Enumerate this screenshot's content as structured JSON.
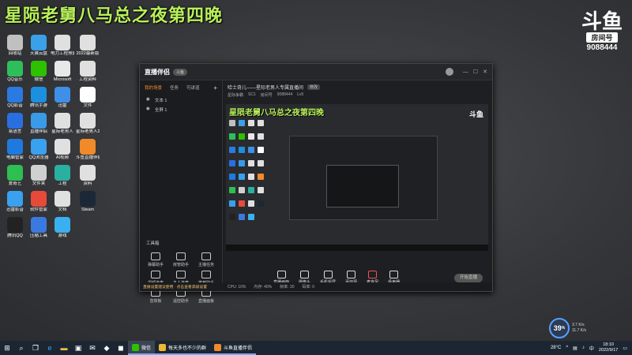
{
  "stream_overlay": {
    "title": "星陨老舅八马总之夜第四晚",
    "platform_mark": "斗鱼",
    "room_label": "房间号",
    "room_number": "9088444"
  },
  "desktop_icons": [
    {
      "label": "回收站",
      "color": "#c0c0c0"
    },
    {
      "label": "天翼云盘",
      "color": "#3aa0e8"
    },
    {
      "label": "电力工程预算",
      "color": "#e0e0e0"
    },
    {
      "label": "2022最新版",
      "color": "#e0e0e0"
    },
    {
      "label": "QQ音乐",
      "color": "#2fbf5a"
    },
    {
      "label": "微信",
      "color": "#2dc100"
    },
    {
      "label": "Microsoft",
      "color": "#e8e8e8"
    },
    {
      "label": "工程资料",
      "color": "#e0e0e0"
    },
    {
      "label": "QQ影音",
      "color": "#2a7ae2"
    },
    {
      "label": "腾讯手游",
      "color": "#1b8fe0"
    },
    {
      "label": "迅雷",
      "color": "#3f8fe8"
    },
    {
      "label": "文件",
      "color": "#ffffff"
    },
    {
      "label": "易语言",
      "color": "#2a6fe0"
    },
    {
      "label": "直播伴侣",
      "color": "#3a9ae8"
    },
    {
      "label": "星际老男人",
      "color": "#e0e0e0"
    },
    {
      "label": "星际老男人2",
      "color": "#e0e0e0"
    },
    {
      "label": "电脑管家",
      "color": "#1f7ae0"
    },
    {
      "label": "QQ浏览器",
      "color": "#3aa0f0"
    },
    {
      "label": "AI视频",
      "color": "#e0e0e0"
    },
    {
      "label": "斗鱼直播伴侣",
      "color": "#f08a2a"
    },
    {
      "label": "爱奇艺",
      "color": "#2dbf4f"
    },
    {
      "label": "文件夹",
      "color": "#d0d0d0"
    },
    {
      "label": "工程",
      "color": "#2ab0a0"
    },
    {
      "label": "资料",
      "color": "#e0e0e0"
    },
    {
      "label": "迅雷影音",
      "color": "#3aa0f0"
    },
    {
      "label": "软件管家",
      "color": "#e84a3a"
    },
    {
      "label": "文档",
      "color": "#e0e0e0"
    },
    {
      "label": "Steam",
      "color": "#1b2838"
    },
    {
      "label": "腾讯QQ",
      "color": "#222"
    },
    {
      "label": "压缩工具",
      "color": "#3a7ae0"
    },
    {
      "label": "游戏",
      "color": "#3ab0f0"
    }
  ],
  "app": {
    "logo": "直播伴侣",
    "version": "斗鱼",
    "tabs": [
      "我的场景",
      "任务",
      "可讲道"
    ],
    "scenes": [
      "文本 1",
      "全屏 1"
    ],
    "tools_title": "工具箱",
    "tools": [
      "弹幕助手",
      "房管助手",
      "主播任务",
      "视频连麦",
      "多人连麦",
      "推荐助手",
      "音效板",
      "遥控助手",
      "直播画板"
    ],
    "room_title": "哈士奇儿——星际老男人专属直播间",
    "room_tag": "修改",
    "room_meta": [
      "星际争霸",
      "SC1",
      "房间号",
      "9088444",
      "Lv5"
    ],
    "actions": [
      "直播画面",
      "摄像头",
      "手机投屏",
      "添加源",
      "麦克风",
      "扬声器"
    ],
    "live_button": "开始直播",
    "status": [
      "CPU: 10%",
      "内存: 40%",
      "帧率: 30",
      "码率: 0"
    ],
    "notice": "直播设置建议使用 · 点击查看高级设置"
  },
  "preview": {
    "title": "星陨老舅八马总之夜第四晚"
  },
  "net_widget": {
    "value": "39",
    "unit": "%",
    "up": "3.7 K/s",
    "down": "11.7 K/s"
  },
  "taskbar": {
    "start": "⊞",
    "apps": [
      {
        "label": "微信",
        "color": "#2dc100"
      },
      {
        "label": "每天多也不少的群",
        "color": "#f0b830"
      },
      {
        "label": "斗鱼直播伴侣",
        "color": "#f08a2a"
      }
    ],
    "temperature": "28°C",
    "time": "18:10",
    "date": "2022/9/17",
    "lang": "中"
  }
}
